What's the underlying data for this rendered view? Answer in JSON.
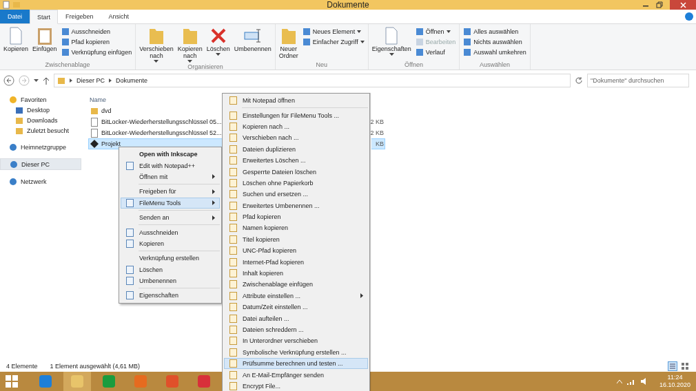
{
  "window": {
    "title": "Dokumente"
  },
  "ribbon_tabs": [
    {
      "label": "Datei",
      "selected": false,
      "kind": "file"
    },
    {
      "label": "Start",
      "selected": true,
      "kind": "tab"
    },
    {
      "label": "Freigeben",
      "selected": false,
      "kind": "tab"
    },
    {
      "label": "Ansicht",
      "selected": false,
      "kind": "tab"
    }
  ],
  "ribbon_groups": [
    {
      "label": "Zwischenablage",
      "large": [
        {
          "label": "Kopieren",
          "dropdown": false
        },
        {
          "label": "Einfügen",
          "dropdown": false
        }
      ],
      "small": [
        {
          "label": "Ausschneiden",
          "disabled": false,
          "caret": false
        },
        {
          "label": "Pfad kopieren",
          "disabled": false,
          "caret": false
        },
        {
          "label": "Verknüpfung einfügen",
          "disabled": false,
          "caret": false
        }
      ]
    },
    {
      "label": "Organisieren",
      "large": [
        {
          "label": "Verschieben nach",
          "dropdown": true
        },
        {
          "label": "Kopieren nach",
          "dropdown": true
        },
        {
          "label": "Löschen",
          "dropdown": true
        },
        {
          "label": "Umbenennen",
          "dropdown": false
        }
      ]
    },
    {
      "label": "Neu",
      "large": [
        {
          "label": "Neuer Ordner",
          "dropdown": false
        }
      ],
      "small": [
        {
          "label": "Neues Element",
          "disabled": false,
          "caret": true
        },
        {
          "label": "Einfacher Zugriff",
          "disabled": false,
          "caret": true
        }
      ]
    },
    {
      "label": "Öffnen",
      "large": [
        {
          "label": "Eigenschaften",
          "dropdown": true
        }
      ],
      "small": [
        {
          "label": "Öffnen",
          "disabled": false,
          "caret": true
        },
        {
          "label": "Bearbeiten",
          "disabled": true,
          "caret": false
        },
        {
          "label": "Verlauf",
          "disabled": false,
          "caret": false
        }
      ]
    },
    {
      "label": "Auswählen",
      "small": [
        {
          "label": "Alles auswählen",
          "disabled": false,
          "caret": false
        },
        {
          "label": "Nichts auswählen",
          "disabled": false,
          "caret": false
        },
        {
          "label": "Auswahl umkehren",
          "disabled": false,
          "caret": false
        }
      ]
    }
  ],
  "address": {
    "crumbs": [
      "Dieser PC",
      "Dokumente"
    ]
  },
  "search": {
    "placeholder": "\"Dokumente\" durchsuchen"
  },
  "sidebar": {
    "items": [
      {
        "label": "Favoriten",
        "selected": false,
        "children": [
          {
            "label": "Desktop",
            "selected": false
          },
          {
            "label": "Downloads",
            "selected": false
          },
          {
            "label": "Zuletzt besucht",
            "selected": false
          }
        ]
      },
      {
        "label": "Heimnetzgruppe",
        "selected": false
      },
      {
        "label": "Dieser PC",
        "selected": true
      },
      {
        "label": "Netzwerk",
        "selected": false
      }
    ]
  },
  "files": {
    "columns": [
      "Name"
    ],
    "rows": [
      {
        "name": "dvd",
        "kind": "folder",
        "selected": false
      },
      {
        "name": "BitLocker-Wiederherstellungsschlüssel 05...",
        "kind": "text",
        "size": "2 KB",
        "selected": false
      },
      {
        "name": "BitLocker-Wiederherstellungsschlüssel 52...",
        "kind": "text",
        "size": "2 KB",
        "selected": false
      },
      {
        "name": "Projekt",
        "kind": "vector",
        "size": "KB",
        "selected": true
      }
    ]
  },
  "context_menu": {
    "groups": [
      [
        {
          "label": "Open with Inkscape",
          "bold": true,
          "icon": false,
          "submenu": false,
          "selected": false
        },
        {
          "label": "Edit with Notepad++",
          "bold": false,
          "icon": true,
          "submenu": false,
          "selected": false
        },
        {
          "label": "Öffnen mit",
          "bold": false,
          "icon": false,
          "submenu": true,
          "selected": false
        }
      ],
      [
        {
          "label": "Freigeben für",
          "bold": false,
          "icon": false,
          "submenu": true,
          "selected": false
        },
        {
          "label": "FileMenu Tools",
          "bold": false,
          "icon": true,
          "submenu": true,
          "selected": true
        }
      ],
      [
        {
          "label": "Senden an",
          "bold": false,
          "icon": false,
          "submenu": true,
          "selected": false
        }
      ],
      [
        {
          "label": "Ausschneiden",
          "bold": false,
          "icon": true,
          "submenu": false,
          "selected": false
        },
        {
          "label": "Kopieren",
          "bold": false,
          "icon": true,
          "submenu": false,
          "selected": false
        }
      ],
      [
        {
          "label": "Verknüpfung erstellen",
          "bold": false,
          "icon": false,
          "submenu": false,
          "selected": false
        },
        {
          "label": "Löschen",
          "bold": false,
          "icon": true,
          "submenu": false,
          "selected": false
        },
        {
          "label": "Umbenennen",
          "bold": false,
          "icon": true,
          "submenu": false,
          "selected": false
        }
      ],
      [
        {
          "label": "Eigenschaften",
          "bold": false,
          "icon": true,
          "submenu": false,
          "selected": false
        }
      ]
    ]
  },
  "submenu": {
    "groups": [
      [
        {
          "label": "Mit Notepad öffnen",
          "submenu": false,
          "selected": false
        }
      ],
      [
        {
          "label": "Einstellungen für FileMenu Tools ...",
          "submenu": false,
          "selected": false
        },
        {
          "label": "Kopieren nach ...",
          "submenu": false,
          "selected": false
        },
        {
          "label": "Verschieben nach ...",
          "submenu": false,
          "selected": false
        },
        {
          "label": "Dateien duplizieren",
          "submenu": false,
          "selected": false
        },
        {
          "label": "Erweitertes Löschen ...",
          "submenu": false,
          "selected": false
        },
        {
          "label": "Gesperrte Dateien löschen",
          "submenu": false,
          "selected": false
        },
        {
          "label": "Löschen ohne Papierkorb",
          "submenu": false,
          "selected": false
        },
        {
          "label": "Suchen und ersetzen ...",
          "submenu": false,
          "selected": false
        },
        {
          "label": "Erweitertes Umbenennen ...",
          "submenu": false,
          "selected": false
        },
        {
          "label": "Pfad kopieren",
          "submenu": false,
          "selected": false
        },
        {
          "label": "Namen kopieren",
          "submenu": false,
          "selected": false
        },
        {
          "label": "Titel kopieren",
          "submenu": false,
          "selected": false
        },
        {
          "label": "UNC-Pfad kopieren",
          "submenu": false,
          "selected": false
        },
        {
          "label": "Internet-Pfad kopieren",
          "submenu": false,
          "selected": false
        },
        {
          "label": "Inhalt kopieren",
          "submenu": false,
          "selected": false
        },
        {
          "label": "Zwischenablage einfügen",
          "submenu": false,
          "selected": false
        },
        {
          "label": "Attribute einstellen ...",
          "submenu": true,
          "selected": false
        },
        {
          "label": "Datum/Zeit einstellen ...",
          "submenu": false,
          "selected": false
        },
        {
          "label": "Datei aufteilen ...",
          "submenu": false,
          "selected": false
        },
        {
          "label": "Dateien schreddern ...",
          "submenu": false,
          "selected": false
        },
        {
          "label": "In Unterordner verschieben",
          "submenu": false,
          "selected": false
        },
        {
          "label": "Symbolische Verknüpfung erstellen ...",
          "submenu": false,
          "selected": false
        },
        {
          "label": "Prüfsumme berechnen und testen ...",
          "submenu": false,
          "selected": true
        },
        {
          "label": "An E-Mail-Empfänger senden",
          "submenu": false,
          "selected": false
        },
        {
          "label": "Encrypt File...",
          "submenu": false,
          "selected": false
        }
      ]
    ]
  },
  "status_bar": {
    "count": "4 Elemente",
    "selection": "1 Element ausgewählt (4,61 MB)"
  },
  "taskbar": {
    "apps": [
      {
        "selected": false
      },
      {
        "selected": true
      },
      {
        "selected": false
      },
      {
        "selected": false
      },
      {
        "selected": false
      },
      {
        "selected": false
      }
    ],
    "time": "11:24",
    "date": "16.10.2020"
  }
}
